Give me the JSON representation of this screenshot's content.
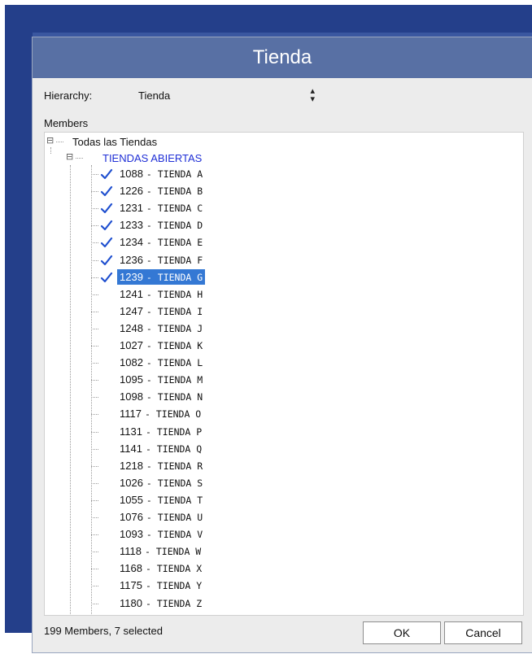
{
  "dialog": {
    "title": "Tienda"
  },
  "hierarchy": {
    "label": "Hierarchy:",
    "value": "Tienda"
  },
  "members": {
    "label": "Members",
    "root": "Todas las Tiendas",
    "group": "TIENDAS ABIERTAS",
    "items": [
      {
        "code": "1088",
        "name": "- TIENDA A",
        "checked": true,
        "selected": false
      },
      {
        "code": "1226",
        "name": "- TIENDA B",
        "checked": true,
        "selected": false
      },
      {
        "code": "1231",
        "name": "- TIENDA C",
        "checked": true,
        "selected": false
      },
      {
        "code": "1233",
        "name": "- TIENDA D",
        "checked": true,
        "selected": false
      },
      {
        "code": "1234",
        "name": "- TIENDA E",
        "checked": true,
        "selected": false
      },
      {
        "code": "1236",
        "name": "- TIENDA F",
        "checked": true,
        "selected": false
      },
      {
        "code": "1239",
        "name": "- TIENDA G",
        "checked": true,
        "selected": true
      },
      {
        "code": "1241",
        "name": "- TIENDA H",
        "checked": false,
        "selected": false
      },
      {
        "code": "1247",
        "name": "- TIENDA I",
        "checked": false,
        "selected": false
      },
      {
        "code": "1248",
        "name": "- TIENDA J",
        "checked": false,
        "selected": false
      },
      {
        "code": "1027",
        "name": "- TIENDA K",
        "checked": false,
        "selected": false
      },
      {
        "code": "1082",
        "name": "- TIENDA L",
        "checked": false,
        "selected": false
      },
      {
        "code": "1095",
        "name": "- TIENDA M",
        "checked": false,
        "selected": false
      },
      {
        "code": "1098",
        "name": "- TIENDA N",
        "checked": false,
        "selected": false
      },
      {
        "code": "1117",
        "name": "- TIENDA O",
        "checked": false,
        "selected": false
      },
      {
        "code": "1131",
        "name": "- TIENDA P",
        "checked": false,
        "selected": false
      },
      {
        "code": "1141",
        "name": "- TIENDA Q",
        "checked": false,
        "selected": false
      },
      {
        "code": "1218",
        "name": "- TIENDA R",
        "checked": false,
        "selected": false
      },
      {
        "code": "1026",
        "name": "- TIENDA S",
        "checked": false,
        "selected": false
      },
      {
        "code": "1055",
        "name": "- TIENDA T",
        "checked": false,
        "selected": false
      },
      {
        "code": "1076",
        "name": "- TIENDA U",
        "checked": false,
        "selected": false
      },
      {
        "code": "1093",
        "name": "- TIENDA V",
        "checked": false,
        "selected": false
      },
      {
        "code": "1118",
        "name": "- TIENDA W",
        "checked": false,
        "selected": false
      },
      {
        "code": "1168",
        "name": "- TIENDA X",
        "checked": false,
        "selected": false
      },
      {
        "code": "1175",
        "name": "- TIENDA Y",
        "checked": false,
        "selected": false
      },
      {
        "code": "1180",
        "name": "- TIENDA Z",
        "checked": false,
        "selected": false
      }
    ]
  },
  "footer": {
    "status": "199 Members, 7 selected",
    "ok_label": "OK",
    "cancel_label": "Cancel"
  },
  "colors": {
    "title_bar": "#5870a4",
    "background": "#243f8a",
    "group_text": "#1f2fd6",
    "check": "#1f4fcf",
    "selection": "#3478d4"
  },
  "icons": {
    "expander": "minus-box-icon",
    "check": "checkmark-icon",
    "select_arrows": "updown-arrows-icon"
  }
}
